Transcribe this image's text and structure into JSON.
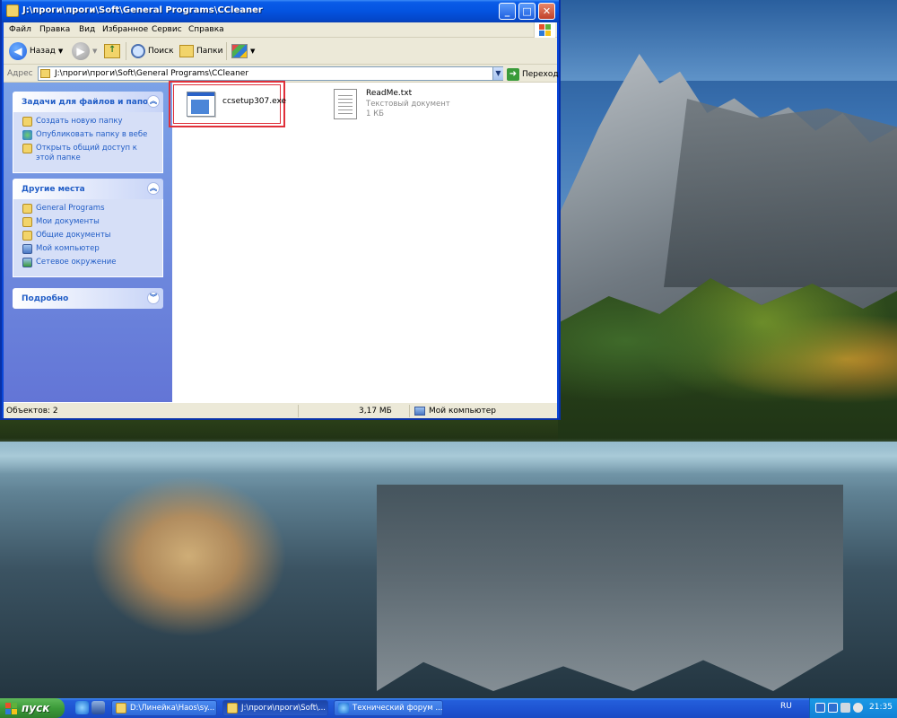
{
  "window": {
    "title": "J:\\проги\\проги\\Soft\\General Programs\\CCleaner",
    "controls": {
      "minimize": "_",
      "maximize": "□",
      "close": "✕"
    }
  },
  "menu": [
    "Файл",
    "Правка",
    "Вид",
    "Избранное",
    "Сервис",
    "Справка"
  ],
  "toolbar": {
    "back_label": "Назад",
    "back_icon": "back-arrow-icon",
    "forward_icon": "forward-arrow-icon",
    "up_icon": "up-folder-icon",
    "search_label": "Поиск",
    "folders_label": "Папки",
    "views_icon": "views-icon"
  },
  "address": {
    "label": "Адрес",
    "value": "J:\\проги\\проги\\Soft\\General Programs\\CCleaner",
    "go_label": "Переход"
  },
  "sidebar": {
    "tasks": {
      "title": "Задачи для файлов и папок",
      "items": [
        {
          "label": "Создать новую папку",
          "icon": "new-folder-icon"
        },
        {
          "label": "Опубликовать папку в вебе",
          "icon": "web-publish-icon"
        },
        {
          "label": "Открыть общий доступ к этой папке",
          "icon": "share-icon"
        }
      ]
    },
    "places": {
      "title": "Другие места",
      "items": [
        {
          "label": "General Programs",
          "icon": "folder-icon"
        },
        {
          "label": "Мои документы",
          "icon": "my-documents-icon"
        },
        {
          "label": "Общие документы",
          "icon": "shared-documents-icon"
        },
        {
          "label": "Мой компьютер",
          "icon": "my-computer-icon"
        },
        {
          "label": "Сетевое окружение",
          "icon": "network-icon"
        }
      ]
    },
    "details": {
      "title": "Подробно"
    }
  },
  "files": [
    {
      "name": "ccsetup307.exe",
      "icon": "exe-installer-icon",
      "selected_highlight": true
    },
    {
      "name": "ReadMe.txt",
      "type": "Текстовый документ",
      "size": "1 КБ",
      "icon": "text-document-icon"
    }
  ],
  "status": {
    "objects": "Объектов: 2",
    "size": "3,17 МБ",
    "location": "Мой компьютер"
  },
  "taskbar": {
    "start_label": "пуск",
    "buttons": [
      {
        "label": "D:\\Линейка\\Наоs\\sy...",
        "active": false
      },
      {
        "label": "J:\\проги\\проги\\Soft\\...",
        "active": true
      },
      {
        "label": "Технический форум ...",
        "active": false
      }
    ],
    "lang": "RU",
    "clock": "21:35"
  },
  "colors": {
    "titlebar": "#0a5ce8",
    "sidebar": "#7ba2e7",
    "link": "#215dc6",
    "highlight": "#e0303a",
    "start": "#3c9b3a"
  }
}
